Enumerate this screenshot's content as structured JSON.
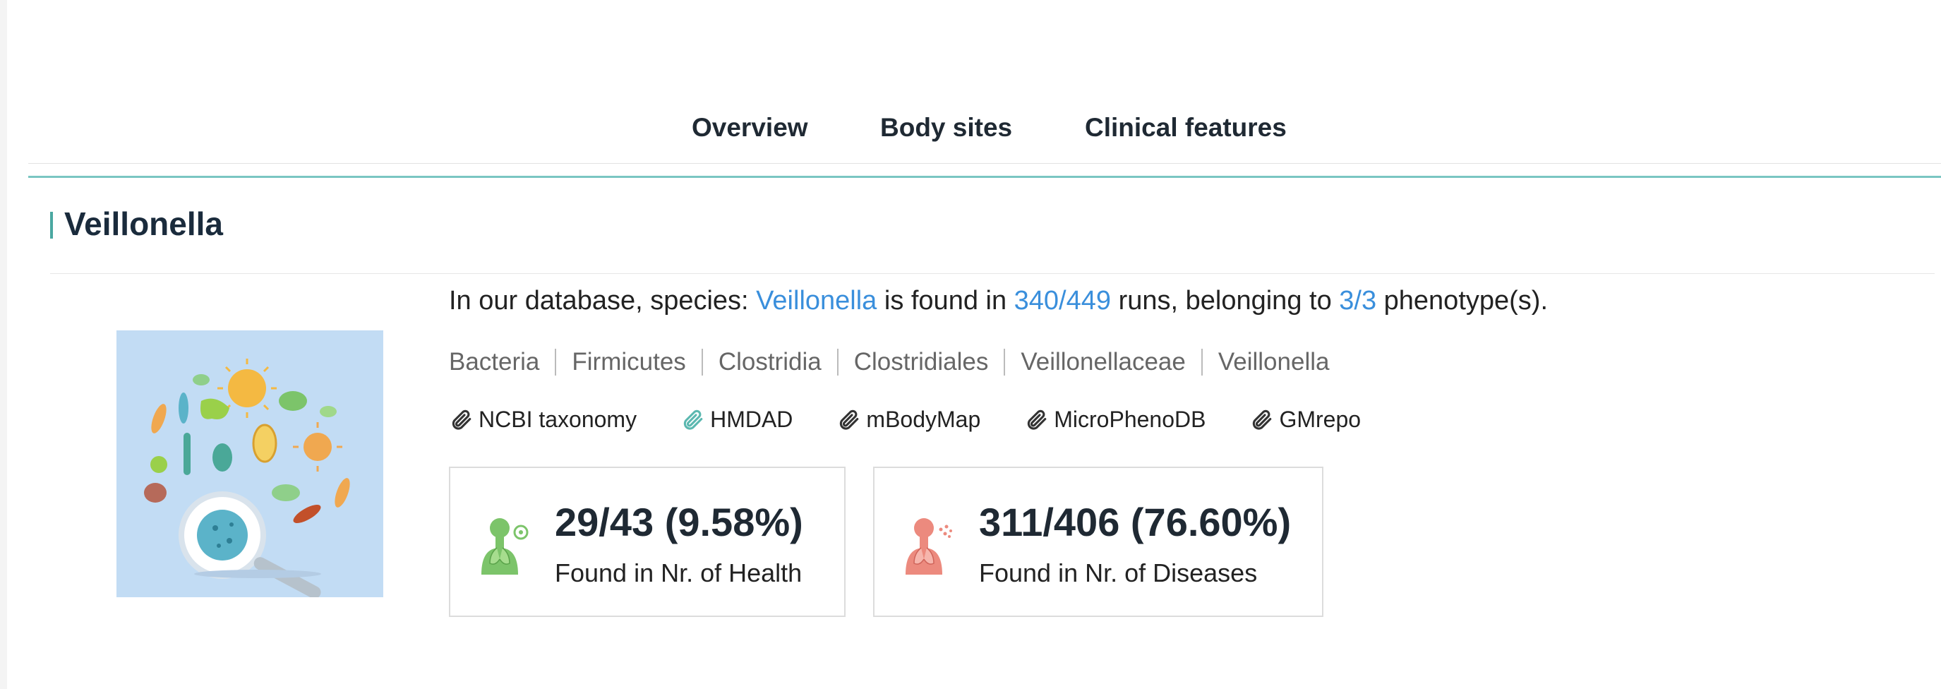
{
  "tabs": [
    {
      "label": "Overview"
    },
    {
      "label": "Body sites"
    },
    {
      "label": "Clinical features"
    }
  ],
  "title": "Veillonella",
  "description": {
    "prefix": "In our database, species: ",
    "species": "Veillonella",
    "mid1": " is found in ",
    "runs": "340/449",
    "mid2": " runs, belonging to ",
    "phenotypes": "3/3",
    "suffix": " phenotype(s)."
  },
  "taxonomy": [
    "Bacteria",
    "Firmicutes",
    "Clostridia",
    "Clostridiales",
    "Veillonellaceae",
    "Veillonella"
  ],
  "links": [
    {
      "label": "NCBI taxonomy",
      "icon": "paperclip-icon"
    },
    {
      "label": "HMDAD",
      "icon": "paperclip-icon"
    },
    {
      "label": "mBodyMap",
      "icon": "paperclip-icon"
    },
    {
      "label": "MicroPhenoDB",
      "icon": "paperclip-icon"
    },
    {
      "label": "GMrepo",
      "icon": "paperclip-icon"
    }
  ],
  "stats": {
    "health": {
      "value": "29/43 (9.58%)",
      "label": "Found in Nr. of Health",
      "color": "#7cc46a"
    },
    "disease": {
      "value": "311/406 (76.60%)",
      "label": "Found in Nr. of Diseases",
      "color": "#ec8a7e"
    }
  },
  "colors": {
    "accent": "#4aa8a1",
    "link": "#3a8fdc",
    "illustration_bg": "#c2dcf4"
  }
}
